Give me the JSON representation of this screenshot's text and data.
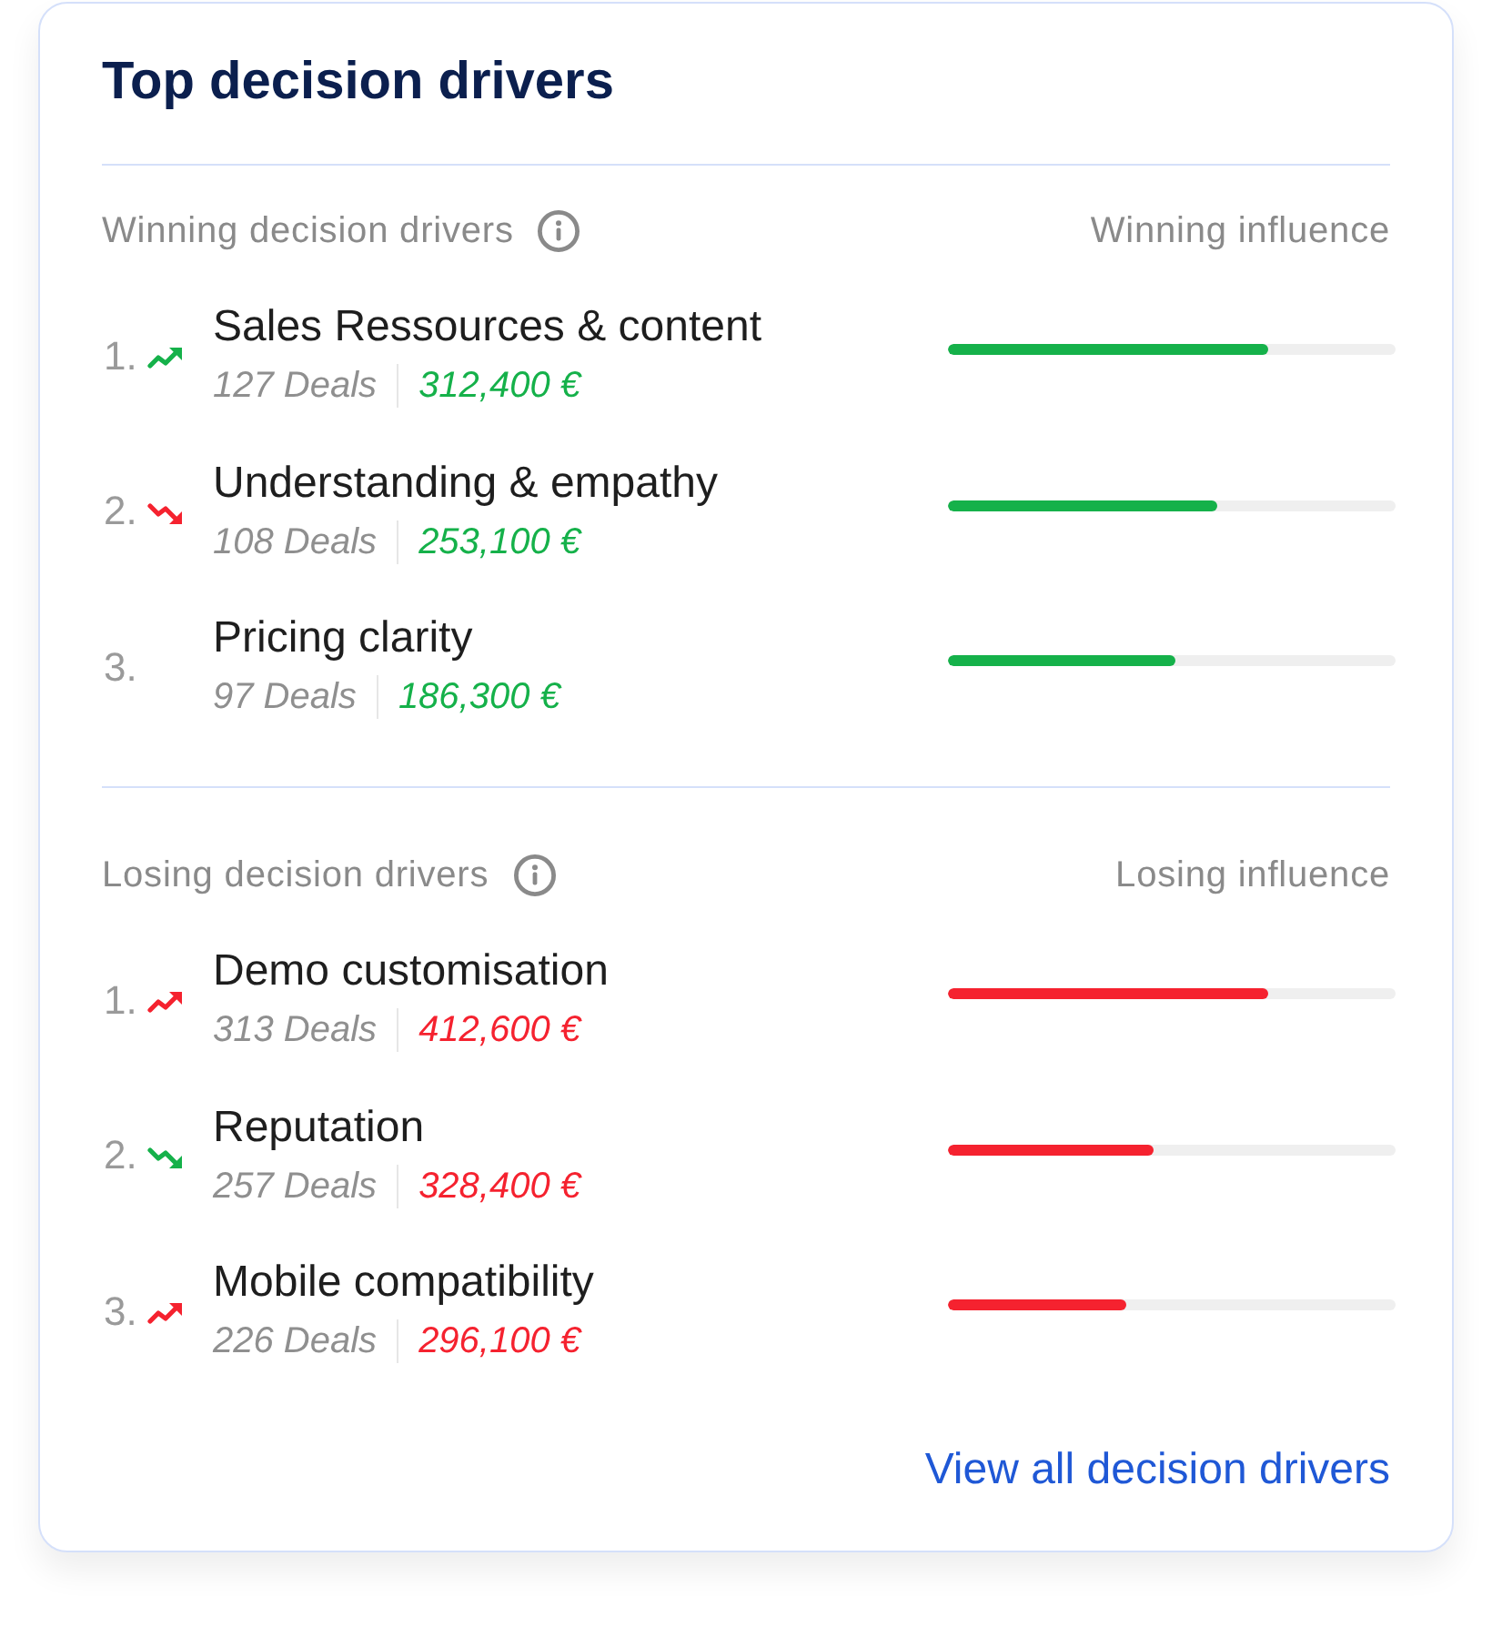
{
  "card": {
    "title": "Top decision drivers"
  },
  "sections": [
    {
      "heading": "Winning decision drivers",
      "column_heading": "Winning influence",
      "color": "#15b14a",
      "drivers": [
        {
          "rank": "1.",
          "trend": {
            "kind": "up",
            "color": "#15b14a"
          },
          "name": "Sales Ressources & content",
          "deals": "127 Deals",
          "amount": "312,400 €",
          "level": 0.715
        },
        {
          "rank": "2.",
          "trend": {
            "kind": "down",
            "color": "#f5222f"
          },
          "name": "Understanding & empathy",
          "deals": "108 Deals",
          "amount": "253,100 €",
          "level": 0.6
        },
        {
          "rank": "3.",
          "name": "Pricing clarity",
          "deals": "97 Deals",
          "amount": "186,300 €",
          "level": 0.51
        }
      ]
    },
    {
      "heading": "Losing decision drivers",
      "column_heading": "Losing influence",
      "color": "#f5222f",
      "drivers": [
        {
          "rank": "1.",
          "trend": {
            "kind": "up",
            "color": "#f5222f"
          },
          "name": "Demo customisation",
          "deals": "313 Deals",
          "amount": "412,600 €",
          "level": 0.715
        },
        {
          "rank": "2.",
          "trend": {
            "kind": "down",
            "color": "#15b14a"
          },
          "name": "Reputation",
          "deals": "257 Deals",
          "amount": "328,400 €",
          "level": 0.46
        },
        {
          "rank": "3.",
          "trend": {
            "kind": "up",
            "color": "#f5222f"
          },
          "name": "Mobile compatibility",
          "deals": "226 Deals",
          "amount": "296,100 €",
          "level": 0.4
        }
      ]
    }
  ],
  "link": "View all decision drivers"
}
